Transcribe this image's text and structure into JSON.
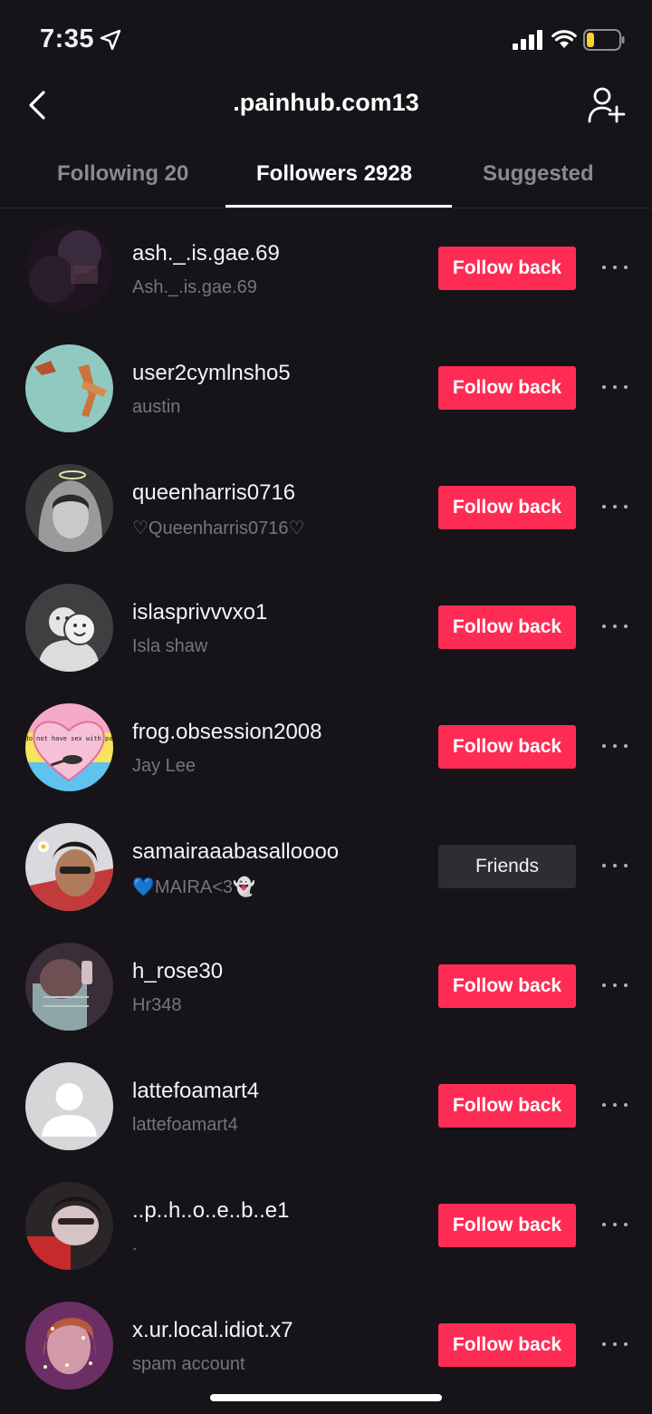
{
  "status_bar": {
    "time": "7:35"
  },
  "header": {
    "title": ".painhub.com13"
  },
  "tabs": [
    {
      "label": "Following 20",
      "active": false
    },
    {
      "label": "Followers 2928",
      "active": true
    },
    {
      "label": "Suggested",
      "active": false
    }
  ],
  "followers": [
    {
      "username": "ash._.is.gae.69",
      "nickname": "Ash._.is.gae.69",
      "action": "Follow back",
      "avatar": "dark-photo"
    },
    {
      "username": "user2cymlnsho5",
      "nickname": "austin",
      "action": "Follow back",
      "avatar": "teal-illustration"
    },
    {
      "username": "queenharris0716",
      "nickname": "♡Queenharris0716♡",
      "action": "Follow back",
      "avatar": "hooded-portrait"
    },
    {
      "username": "islasprivvvxo1",
      "nickname": "Isla shaw",
      "action": "Follow back",
      "avatar": "smiley-faces"
    },
    {
      "username": "frog.obsession2008",
      "nickname": "Jay Lee",
      "action": "Follow back",
      "avatar": "pan-heart",
      "avatar_text": "i do not have sex with pans"
    },
    {
      "username": "samairaaabasalloooo",
      "nickname": "💙MAIRA<3👻",
      "action": "Friends",
      "avatar": "selfie-red"
    },
    {
      "username": "h_rose30",
      "nickname": "Hr348",
      "action": "Follow back",
      "avatar": "mirror-selfie"
    },
    {
      "username": "lattefoamart4",
      "nickname": "lattefoamart4",
      "action": "Follow back",
      "avatar": "default-user"
    },
    {
      "username": "..p..h..o..e..b..e1",
      "nickname": ".",
      "action": "Follow back",
      "avatar": "selfie-dark"
    },
    {
      "username": "x.ur.local.idiot.x7",
      "nickname": "spam account",
      "action": "Follow back",
      "avatar": "sparkle-selfie"
    }
  ],
  "colors": {
    "background": "#161319",
    "accent": "#fe2c55",
    "friends_button": "#2f2c33",
    "secondary_text": "#77757b"
  }
}
